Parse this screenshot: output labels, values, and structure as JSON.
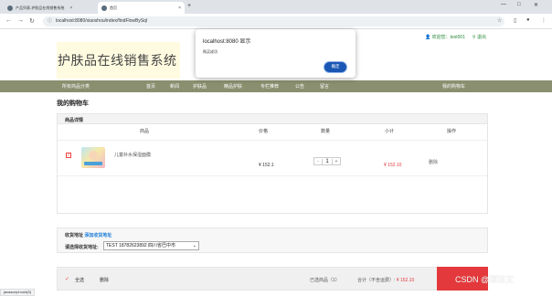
{
  "browser": {
    "tabs": [
      {
        "title": "产品列表-护肤品在线销售系统",
        "active": false
      },
      {
        "title": "首页",
        "active": true
      }
    ],
    "new_tab": "+",
    "url": "localhost:8080/xiaoshou/index/findFlowBySql",
    "status_text": "javascript:void(0)"
  },
  "site": {
    "logo_text": "护肤品在线销售系统",
    "welcome": "欢迎您：test001",
    "logout": "退出",
    "nav": [
      {
        "label": "所有商品分类"
      },
      {
        "label": "首页"
      },
      {
        "label": "新闻"
      },
      {
        "label": "护肤品"
      },
      {
        "label": "精品护肤"
      },
      {
        "label": "专栏推荐"
      },
      {
        "label": "公告"
      },
      {
        "label": "留言"
      }
    ],
    "nav_cart": "我的购物车"
  },
  "cart": {
    "page_title": "我的购物车",
    "section_title": "商品详情",
    "columns": [
      "商品",
      "价格",
      "数量",
      "小计",
      "操作"
    ],
    "items": [
      {
        "name": "儿童补水保湿面膜",
        "price": "¥ 152.1",
        "quantity": "1",
        "minus": "-",
        "plus": "+",
        "subtotal": "¥ 152.10",
        "action": "删除",
        "checked": true
      }
    ]
  },
  "address": {
    "title": "收货地址",
    "add_link": "添加收货地址",
    "select_label": "请选择收货地址:",
    "selected": "TEST   18782623892   四川省巴中市"
  },
  "footer": {
    "select_all": "全选",
    "delete": "删除",
    "selected_count": "已选商品（1）",
    "total_label": "合计（不含运费）:",
    "total_value": "¥ 152.10"
  },
  "dialog": {
    "title": "localhost:8080 显示",
    "message": "购买成功",
    "ok_label": "确定"
  },
  "watermark": "CSDN @郑洁文",
  "colors": {
    "nav_bg": "#8a8f6f",
    "accent_red": "#e4393c",
    "link_blue": "#1f7fd8",
    "dialog_button": "#1a56b3",
    "welcome_green": "#2a8a3a"
  }
}
